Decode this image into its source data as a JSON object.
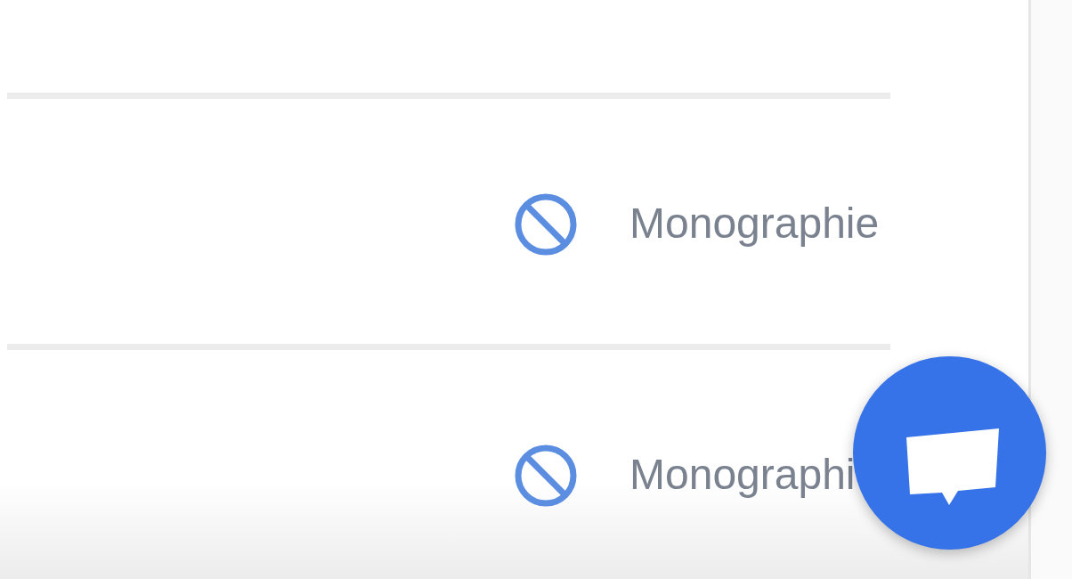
{
  "rows": [
    {
      "label": "Monographie"
    },
    {
      "label": "Monographi"
    }
  ]
}
